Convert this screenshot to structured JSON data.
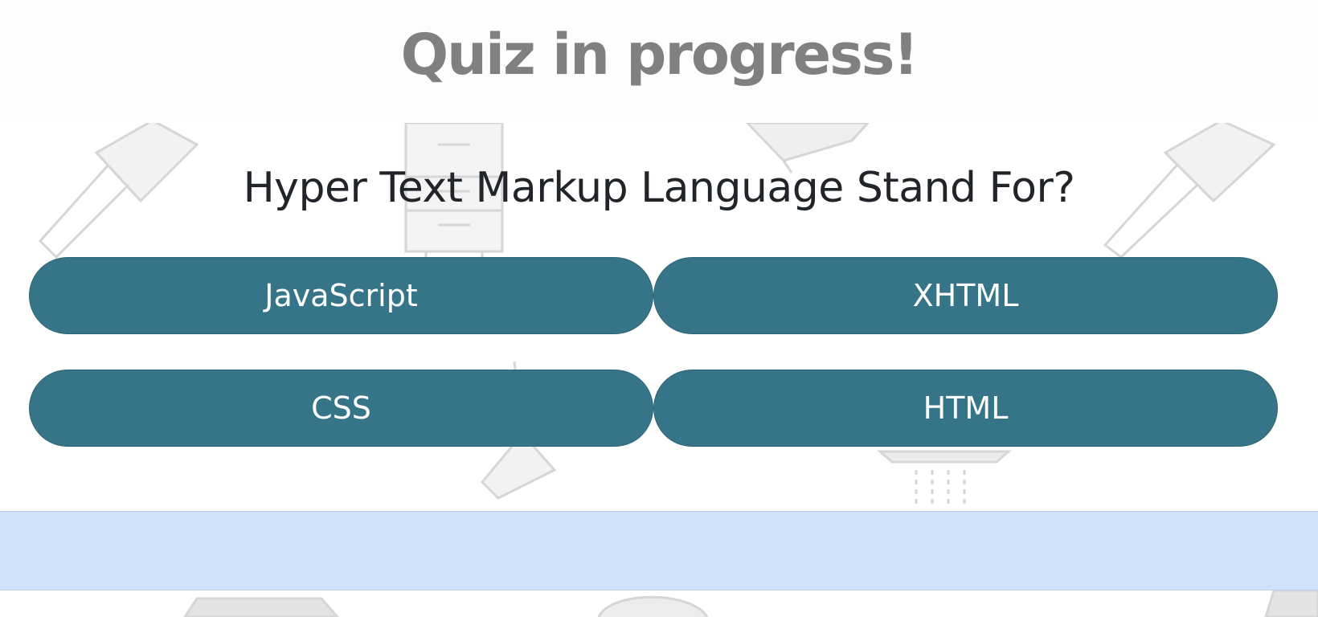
{
  "header": {
    "title": "Quiz in progress!"
  },
  "quiz": {
    "question": "Hyper Text Markup Language Stand For?",
    "answers": [
      {
        "label": "JavaScript"
      },
      {
        "label": "XHTML"
      },
      {
        "label": "CSS"
      },
      {
        "label": "HTML"
      }
    ]
  },
  "result": {
    "message": ""
  },
  "colors": {
    "button": "#367588",
    "result_bar": "#cfe2f8",
    "title": "#808080",
    "question": "#212529"
  }
}
